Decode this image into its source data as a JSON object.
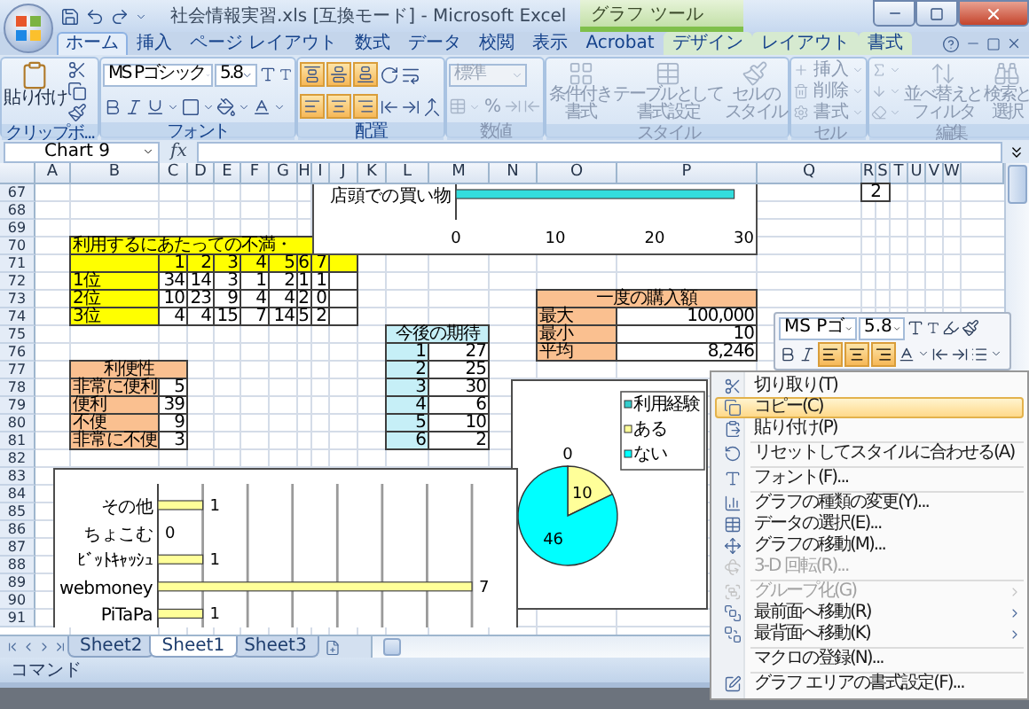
{
  "title_bar": {
    "title": "社会情報実習.xls  [互換モード] - Microsoft Excel",
    "context_title": "グラフ ツール"
  },
  "ribbon_tabs": [
    {
      "label": "ホーム",
      "selected": true,
      "contextual": false
    },
    {
      "label": "挿入",
      "selected": false,
      "contextual": false
    },
    {
      "label": "ページ レイアウト",
      "selected": false,
      "contextual": false
    },
    {
      "label": "数式",
      "selected": false,
      "contextual": false
    },
    {
      "label": "データ",
      "selected": false,
      "contextual": false
    },
    {
      "label": "校閲",
      "selected": false,
      "contextual": false
    },
    {
      "label": "表示",
      "selected": false,
      "contextual": false
    },
    {
      "label": "Acrobat",
      "selected": false,
      "contextual": false
    },
    {
      "label": "デザイン",
      "selected": false,
      "contextual": true
    },
    {
      "label": "レイアウト",
      "selected": false,
      "contextual": true
    },
    {
      "label": "書式",
      "selected": false,
      "contextual": true
    }
  ],
  "ribbon_groups": [
    {
      "kind": "clipboard",
      "label": "クリップボ...",
      "disabled": false,
      "paste": "貼り付け"
    },
    {
      "kind": "font",
      "label": "フォント",
      "disabled": false,
      "font_name": "MS Pゴシック",
      "font_size": "5.8"
    },
    {
      "kind": "alignment",
      "label": "配置",
      "disabled": false,
      "buttons": [
        {
          "selected": true
        },
        {
          "selected": true
        },
        {
          "selected": true
        },
        {
          "selected": true
        },
        {
          "selected": true
        },
        {
          "selected": true
        }
      ]
    },
    {
      "kind": "number",
      "label": "数値",
      "disabled": true,
      "format": "標準",
      "symbol": "%"
    },
    {
      "kind": "styles",
      "label": "スタイル",
      "disabled": true,
      "buttons": [
        {
          "lines": [
            "条件付き",
            "書式"
          ]
        },
        {
          "lines": [
            "テーブルとして",
            "書式設定"
          ]
        },
        {
          "lines": [
            "セルの",
            "スタイル"
          ]
        }
      ]
    },
    {
      "kind": "cells",
      "label": "セル",
      "disabled": true,
      "buttons": [
        "挿入",
        "削除",
        "書式"
      ]
    },
    {
      "kind": "editing",
      "label": "編集",
      "disabled": true,
      "buttons": [
        {
          "lines": [
            "並べ替えと",
            "フィルタ"
          ]
        },
        {
          "lines": [
            "検索と",
            "選択"
          ]
        }
      ]
    }
  ],
  "formula_bar": {
    "name_box": "Chart 9",
    "function_label": "fx"
  },
  "columns": [
    "A",
    "B",
    "C",
    "D",
    "E",
    "F",
    "G",
    "H",
    "I",
    "J",
    "K",
    "L",
    "M",
    "N",
    "O",
    "P",
    "Q",
    "R",
    "S",
    "T",
    "U",
    "V",
    "W"
  ],
  "rows": [
    "67",
    "68",
    "69",
    "70",
    "71",
    "72",
    "73",
    "74",
    "75",
    "76",
    "77",
    "78",
    "79",
    "80",
    "81",
    "82",
    "83",
    "84",
    "85",
    "86",
    "87",
    "88",
    "89",
    "90",
    "91"
  ],
  "tables": [
    {
      "kind": "ranking",
      "color": "#ffff00",
      "title": "利用するにあたっての不満・",
      "header": [
        "1",
        "2",
        "3",
        "4",
        "5",
        "6",
        "7"
      ],
      "rows": [
        {
          "label": "1位",
          "values": [
            "34",
            "14",
            "3",
            "1",
            "2",
            "1",
            "1"
          ]
        },
        {
          "label": "2位",
          "values": [
            "10",
            "23",
            "9",
            "4",
            "4",
            "2",
            "0"
          ]
        },
        {
          "label": "3位",
          "values": [
            "4",
            "4",
            "15",
            "7",
            "14",
            "5",
            "2"
          ]
        }
      ]
    },
    {
      "kind": "list",
      "color": "#fac090",
      "title": "利便性",
      "rows": [
        {
          "label": "非常に便利",
          "values": [
            "5"
          ]
        },
        {
          "label": "便利",
          "values": [
            "39"
          ]
        },
        {
          "label": "不便",
          "values": [
            "9"
          ]
        },
        {
          "label": "非常に不便",
          "values": [
            "3"
          ]
        }
      ]
    },
    {
      "kind": "numbered",
      "color": "#c6eff7",
      "title": "今後の期待",
      "rows": [
        {
          "label": "1",
          "values": [
            "27"
          ]
        },
        {
          "label": "2",
          "values": [
            "25"
          ]
        },
        {
          "label": "3",
          "values": [
            "30"
          ]
        },
        {
          "label": "4",
          "values": [
            "6"
          ]
        },
        {
          "label": "5",
          "values": [
            "10"
          ]
        },
        {
          "label": "6",
          "values": [
            "2"
          ]
        }
      ]
    },
    {
      "kind": "list",
      "color": "#fac090",
      "title": "一度の購入額",
      "rows": [
        {
          "label": "最大",
          "values": [
            "100,000"
          ]
        },
        {
          "label": "最小",
          "values": [
            "10"
          ]
        },
        {
          "label": "平均",
          "values": [
            "8,246"
          ]
        }
      ]
    }
  ],
  "loose_cells": [
    {
      "text": "2"
    }
  ],
  "charts": [
    {
      "chart_data": {
        "type": "bar",
        "orientation": "horizontal",
        "categories": [
          "店頭での買い物"
        ],
        "series": [
          {
            "color": "#33dddd",
            "values": [
              28
            ]
          }
        ],
        "xlim": [
          0,
          30
        ],
        "xticks": [
          0,
          10,
          20,
          30
        ]
      }
    },
    {
      "slices": [
        {
          "color": "#33cccc"
        },
        {
          "color": "#ffff99"
        },
        {
          "color": "#00ffff"
        }
      ],
      "chart_data": {
        "type": "pie",
        "categories": [
          "利用経験",
          "ある",
          "ない"
        ],
        "values": [
          0,
          10,
          46
        ],
        "value_labels": [
          "0",
          "10",
          "46"
        ],
        "legend": "right"
      }
    },
    {
      "chart_data": {
        "type": "bar",
        "orientation": "horizontal",
        "categories": [
          "その他",
          "ちょこむ",
          "ﾋﾞｯﾄｷｬｯｼｭ",
          "webmoney",
          "PiTaPa"
        ],
        "series": [
          {
            "color": "#ffff99",
            "values": [
              1,
              0,
              1,
              7,
              1
            ]
          }
        ],
        "data_labels": true
      }
    }
  ],
  "mini_toolbar": {
    "font_name": "MS Pゴ",
    "font_size": "5.8",
    "align_buttons": [
      {
        "selected": true
      },
      {
        "selected": true
      },
      {
        "selected": true
      }
    ]
  },
  "context_menu": [
    {
      "kind": "item",
      "label": "切り取り(T)",
      "selected": false,
      "disabled": false,
      "submenu": false
    },
    {
      "kind": "item",
      "label": "コピー(C)",
      "selected": true,
      "disabled": false,
      "submenu": false
    },
    {
      "kind": "item",
      "label": "貼り付け(P)",
      "selected": false,
      "disabled": false,
      "submenu": false
    },
    {
      "kind": "separator"
    },
    {
      "kind": "item",
      "label": "リセットしてスタイルに合わせる(A)",
      "selected": false,
      "disabled": false,
      "submenu": false
    },
    {
      "kind": "separator"
    },
    {
      "kind": "item",
      "label": "フォント(F)...",
      "selected": false,
      "disabled": false,
      "submenu": false
    },
    {
      "kind": "separator"
    },
    {
      "kind": "item",
      "label": "グラフの種類の変更(Y)...",
      "selected": false,
      "disabled": false,
      "submenu": false
    },
    {
      "kind": "item",
      "label": "データの選択(E)...",
      "selected": false,
      "disabled": false,
      "submenu": false
    },
    {
      "kind": "item",
      "label": "グラフの移動(M)...",
      "selected": false,
      "disabled": false,
      "submenu": false
    },
    {
      "kind": "item",
      "label": "3-D 回転(R)...",
      "selected": false,
      "disabled": true,
      "submenu": false
    },
    {
      "kind": "separator"
    },
    {
      "kind": "item",
      "label": "グループ化(G)",
      "selected": false,
      "disabled": true,
      "submenu": true
    },
    {
      "kind": "item",
      "label": "最前面へ移動(R)",
      "selected": false,
      "disabled": false,
      "submenu": true
    },
    {
      "kind": "item",
      "label": "最背面へ移動(K)",
      "selected": false,
      "disabled": false,
      "submenu": true
    },
    {
      "kind": "separator"
    },
    {
      "kind": "item",
      "label": "マクロの登録(N)...",
      "selected": false,
      "disabled": false,
      "submenu": false
    },
    {
      "kind": "separator"
    },
    {
      "kind": "item",
      "label": "グラフ エリアの書式設定(F)...",
      "selected": false,
      "disabled": false,
      "submenu": false
    }
  ],
  "sheet_tabs": [
    {
      "label": "Sheet2",
      "selected": false
    },
    {
      "label": "Sheet1",
      "selected": true
    },
    {
      "label": "Sheet3",
      "selected": false
    }
  ],
  "status_bar": {
    "text": "コマンド"
  }
}
